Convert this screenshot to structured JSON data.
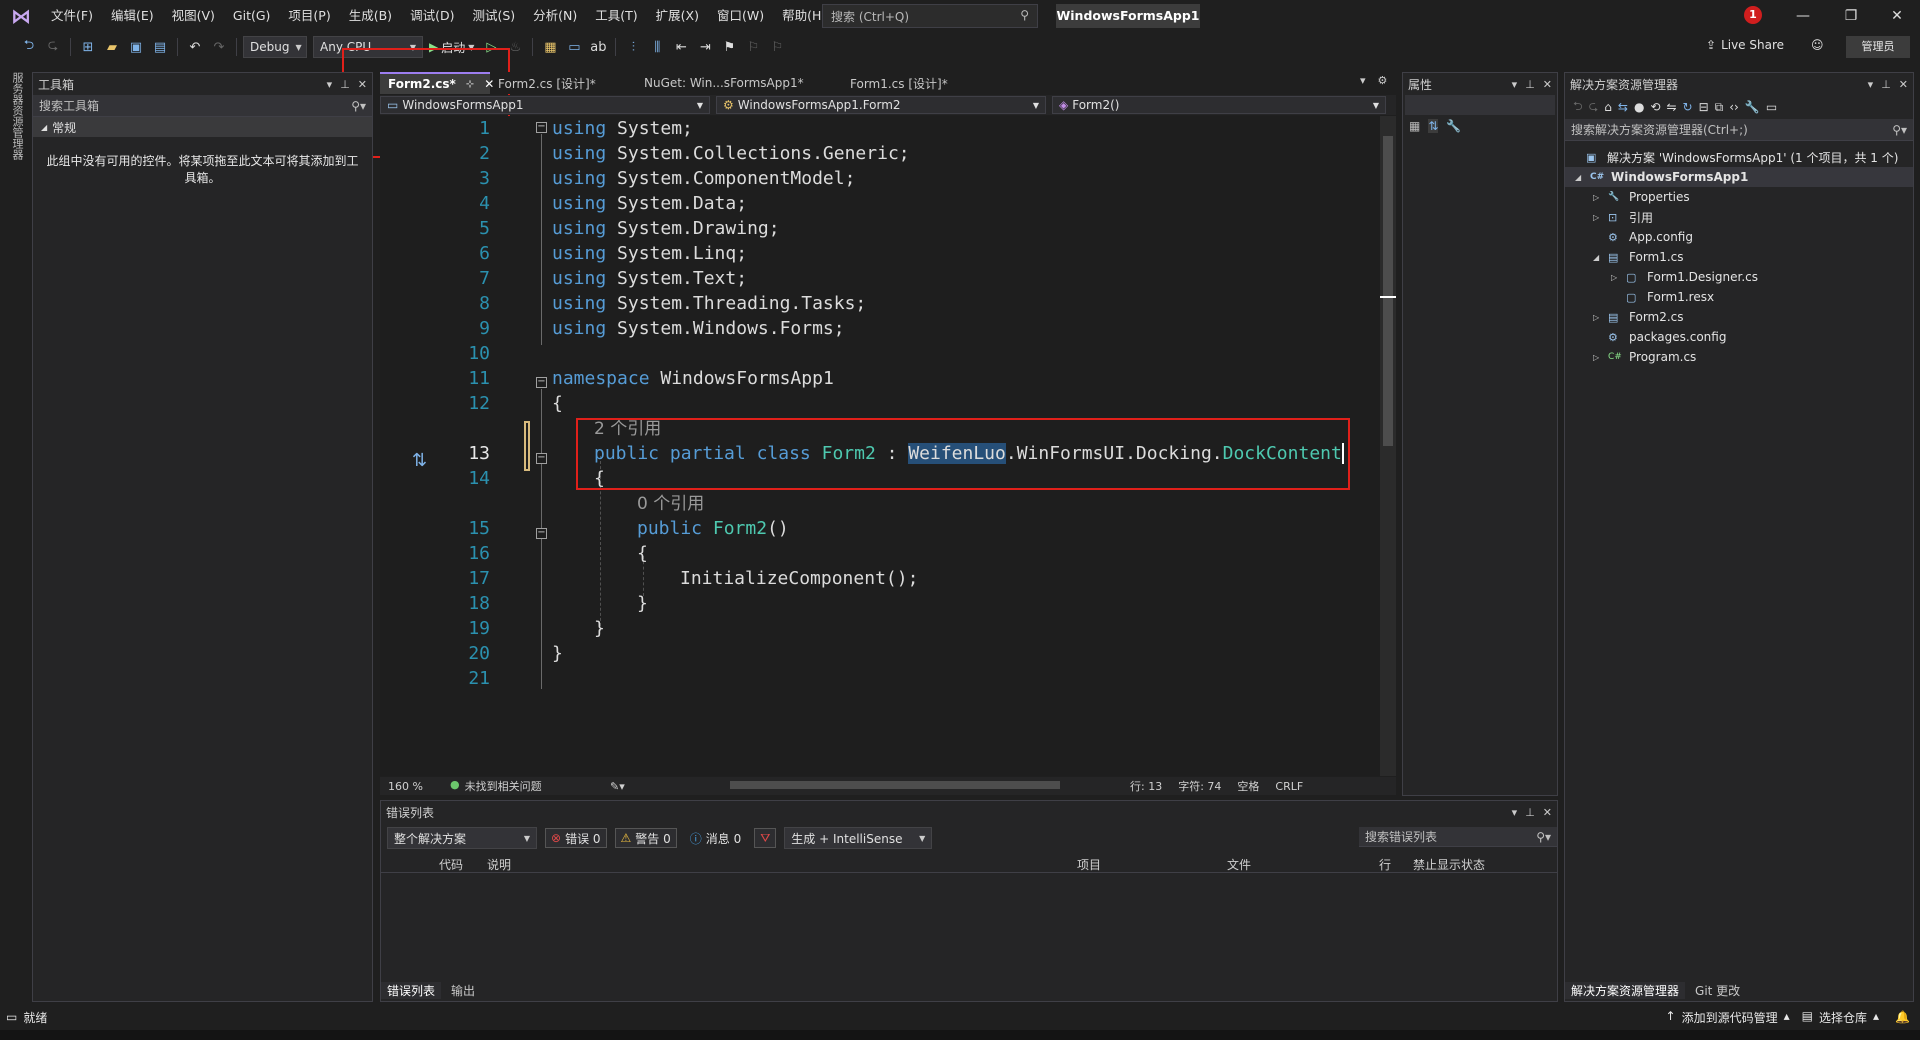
{
  "titlebar": {
    "menu": [
      "文件(F)",
      "编辑(E)",
      "视图(V)",
      "Git(G)",
      "项目(P)",
      "生成(B)",
      "调试(D)",
      "测试(S)",
      "分析(N)",
      "工具(T)",
      "扩展(X)",
      "窗口(W)",
      "帮助(H)"
    ],
    "search_placeholder": "搜索 (Ctrl+Q)",
    "app_name": "WindowsFormsApp1",
    "notification_count": "1"
  },
  "toolbar": {
    "config": "Debug",
    "platform": "Any CPU",
    "start_label": "启动",
    "live_share": "Live Share",
    "admin": "管理员"
  },
  "left_strip": {
    "label": "服务器资源管理器"
  },
  "toolbox": {
    "title": "工具箱",
    "search_placeholder": "搜索工具箱",
    "group": "常规",
    "empty_message": "此组中没有可用的控件。将某项拖至此文本可将其添加到工具箱。"
  },
  "editor": {
    "tabs": [
      {
        "label": "Form2.cs*",
        "active": true
      },
      {
        "label": "Form2.cs [设计]*",
        "active": false
      },
      {
        "label": "NuGet: Win...sFormsApp1*",
        "active": false
      },
      {
        "label": "Form1.cs [设计]*",
        "active": false
      }
    ],
    "nav_project": "WindowsFormsApp1",
    "nav_class": "WindowsFormsApp1.Form2",
    "nav_member": "Form2()",
    "code_lines": [
      {
        "n": "1",
        "using": "using",
        "ns": " System;"
      },
      {
        "n": "2",
        "using": "using",
        "ns": " System.Collections.Generic;"
      },
      {
        "n": "3",
        "using": "using",
        "ns": " System.ComponentModel;"
      },
      {
        "n": "4",
        "using": "using",
        "ns": " System.Data;"
      },
      {
        "n": "5",
        "using": "using",
        "ns": " System.Drawing;"
      },
      {
        "n": "6",
        "using": "using",
        "ns": " System.Linq;"
      },
      {
        "n": "7",
        "using": "using",
        "ns": " System.Text;"
      },
      {
        "n": "8",
        "using": "using",
        "ns": " System.Threading.Tasks;"
      },
      {
        "n": "9",
        "using": "using",
        "ns": " System.Windows.Forms;"
      }
    ],
    "line10": "10",
    "line11": "11",
    "line12": "12",
    "line13": "13",
    "line14": "14",
    "line15": "15",
    "line16": "16",
    "line17": "17",
    "line18": "18",
    "line19": "19",
    "line20": "20",
    "line21": "21",
    "kw_namespace": "namespace",
    "namespace_name": " WindowsFormsApp1",
    "brace_open": "{",
    "brace_close": "}",
    "refs_class": "2 个引用",
    "kw_public": "public",
    "kw_partial": "partial",
    "kw_class": "class",
    "class_name": "Form2",
    "colon": " : ",
    "base_part1": "WeifenLuo",
    "base_dot1": ".",
    "base_part2": "WinFormsUI",
    "base_dot2": ".",
    "base_part3": "Docking",
    "base_dot3": ".",
    "base_part4": "DockContent",
    "refs_ctor": "0 个引用",
    "ctor_name": "Form2",
    "ctor_parens": "()",
    "init_call": "InitializeComponent();",
    "status": {
      "zoom": "160 %",
      "issues": "未找到相关问题",
      "line": "行: 13",
      "char": "字符: 74",
      "space": "空格",
      "eol": "CRLF"
    }
  },
  "properties": {
    "title": "属性"
  },
  "solution": {
    "title": "解决方案资源管理器",
    "search_placeholder": "搜索解决方案资源管理器(Ctrl+;)",
    "tree": [
      {
        "label": "解决方案 'WindowsFormsApp1' (1 个项目，共 1 个)",
        "icon": "solution-icon",
        "glyph": "▣",
        "exp": "",
        "indent": 0,
        "bold": false
      },
      {
        "label": "WindowsFormsApp1",
        "icon": "csharp-project-icon",
        "glyph": "C#",
        "exp": "◢",
        "indent": 1,
        "bold": true
      },
      {
        "label": "Properties",
        "icon": "wrench-icon",
        "glyph": "🔧",
        "exp": "▷",
        "indent": 2,
        "bold": false
      },
      {
        "label": "引用",
        "icon": "references-icon",
        "glyph": "⊡",
        "exp": "▷",
        "indent": 2,
        "bold": false
      },
      {
        "label": "App.config",
        "icon": "config-file-icon",
        "glyph": "⚙",
        "exp": "",
        "indent": 2,
        "bold": false
      },
      {
        "label": "Form1.cs",
        "icon": "form-icon",
        "glyph": "▤",
        "exp": "◢",
        "indent": 2,
        "bold": false
      },
      {
        "label": "Form1.Designer.cs",
        "icon": "csharp-file-icon",
        "glyph": "▢",
        "exp": "▷",
        "indent": 3,
        "bold": false
      },
      {
        "label": "Form1.resx",
        "icon": "resx-file-icon",
        "glyph": "▢",
        "exp": "",
        "indent": 3,
        "bold": false
      },
      {
        "label": "Form2.cs",
        "icon": "form-icon",
        "glyph": "▤",
        "exp": "▷",
        "indent": 2,
        "bold": false
      },
      {
        "label": "packages.config",
        "icon": "config-file-icon",
        "glyph": "⚙",
        "exp": "",
        "indent": 2,
        "bold": false
      },
      {
        "label": "Program.cs",
        "icon": "csharp-file-icon",
        "glyph": "C#",
        "exp": "▷",
        "indent": 2,
        "bold": false
      }
    ],
    "bottom_tabs": [
      "解决方案资源管理器",
      "Git 更改"
    ]
  },
  "errorlist": {
    "title": "错误列表",
    "scope": "整个解决方案",
    "errors": "错误 0",
    "warnings": "警告 0",
    "messages": "消息 0",
    "build_filter": "生成 + IntelliSense",
    "search_placeholder": "搜索错误列表",
    "columns": [
      "代码",
      "说明",
      "项目",
      "文件",
      "行",
      "禁止显示状态"
    ],
    "bottom_tabs": [
      "错误列表",
      "输出"
    ]
  },
  "statusbar": {
    "ready": "就绪",
    "add_source_control": "添加到源代码管理",
    "select_repo": "选择仓库"
  },
  "colors": {
    "accent": "#9d7ef0",
    "highlight_red": "#e0201a",
    "selection": "#264f78"
  }
}
